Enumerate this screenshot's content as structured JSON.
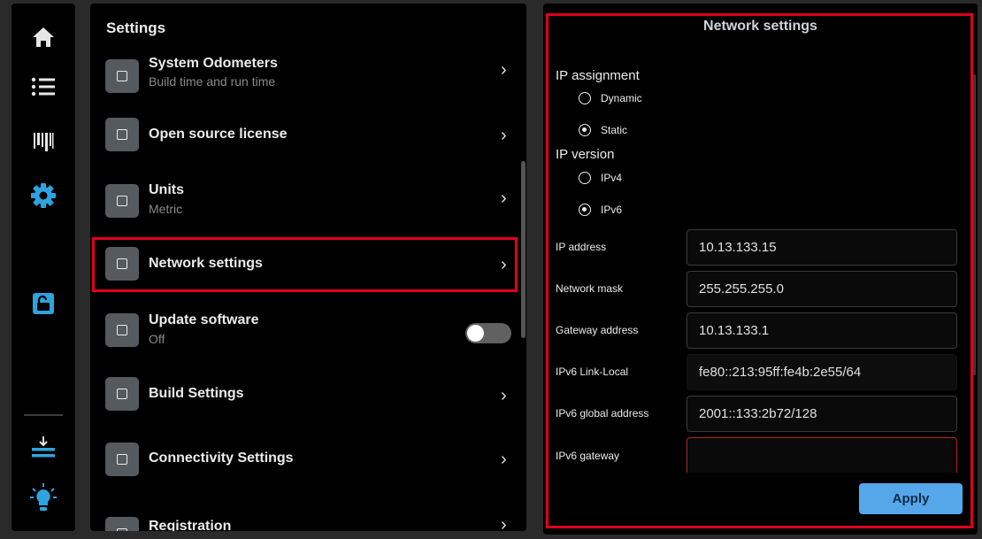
{
  "settings": {
    "title": "Settings",
    "rows": [
      {
        "label": "System Odometers",
        "sub": "Build time and run time"
      },
      {
        "label": "Open source license",
        "sub": ""
      },
      {
        "label": "Units",
        "sub": "Metric"
      },
      {
        "label": "Network settings",
        "sub": ""
      },
      {
        "label": "Update software",
        "sub": "Off"
      },
      {
        "label": "Build Settings",
        "sub": ""
      },
      {
        "label": "Connectivity Settings",
        "sub": ""
      },
      {
        "label": "Registration",
        "sub": ""
      }
    ],
    "chevron": "›",
    "update_toggle_on": false
  },
  "network": {
    "title": "Network settings",
    "ip_assignment": {
      "title": "IP assignment",
      "options": [
        "Dynamic",
        "Static"
      ],
      "selected": "Static"
    },
    "ip_version": {
      "title": "IP version",
      "options": [
        "IPv4",
        "IPv6"
      ],
      "selected": "IPv6"
    },
    "fields": [
      {
        "label": "IP address",
        "value": "10.13.133.15"
      },
      {
        "label": "Network mask",
        "value": "255.255.255.0"
      },
      {
        "label": "Gateway address",
        "value": "10.13.133.1"
      },
      {
        "label": "IPv6 Link-Local",
        "value": "fe80::213:95ff:fe4b:2e55/64"
      },
      {
        "label": "IPv6 global address",
        "value": "2001::133:2b72/128"
      },
      {
        "label": "IPv6 gateway",
        "value": ""
      }
    ],
    "apply_label": "Apply"
  },
  "rail": {
    "icons": [
      "home-icon",
      "list-icon",
      "barcode-icon",
      "gear-icon",
      "unlock-icon",
      "download-icon",
      "lightbulb-icon"
    ],
    "active": "gear-icon"
  },
  "colors": {
    "accent": "#2ea3df",
    "highlight": "#e0001b",
    "apply_button": "#56a6ea"
  }
}
